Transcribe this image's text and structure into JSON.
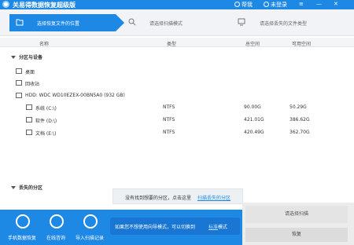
{
  "titlebar": {
    "title": "关易得数据恢复超级版",
    "feedback": "帮我",
    "login": "未登录"
  },
  "steps": [
    {
      "label": "选择恢复文件的位置"
    },
    {
      "label": "请选择扫描模式"
    },
    {
      "label": "请选择丢失的文件类型"
    }
  ],
  "table": {
    "headers": [
      "名称",
      "类型",
      "总空间",
      "可用空间"
    ],
    "section_partitions": "分区与设备",
    "desktop": "桌面",
    "recycle": "回收站",
    "disk": "HDD: WDC WD10EZEX-00BN5A0 (932 GB)",
    "rows": [
      {
        "name": "系统 (C:\\)",
        "type": "NTFS",
        "total": "90.00G",
        "free": "50.29G"
      },
      {
        "name": "软件 (D:\\)",
        "type": "NTFS",
        "total": "421.01G",
        "free": "386.62G"
      },
      {
        "name": "文档 (E:\\)",
        "type": "NTFS",
        "total": "420.49G",
        "free": "362.70G"
      }
    ],
    "section_lost": "丢失的分区"
  },
  "no_partition": {
    "text": "没有找到想要的分区，点击这里",
    "link": "扫描丢失的分区"
  },
  "bottom": {
    "buttons": [
      {
        "label": "手机数据恢复"
      },
      {
        "label": "在线咨询"
      },
      {
        "label": "导入扫描记录"
      }
    ],
    "info": "如果您不想使用向导模式，可以切换到",
    "info_link": "标准",
    "info_end": "模式",
    "next_label": "请选择扫描",
    "bottom_label": "恢复"
  },
  "colors": {
    "primary": "#1e88e5",
    "accent_dark": "#1976d2"
  }
}
